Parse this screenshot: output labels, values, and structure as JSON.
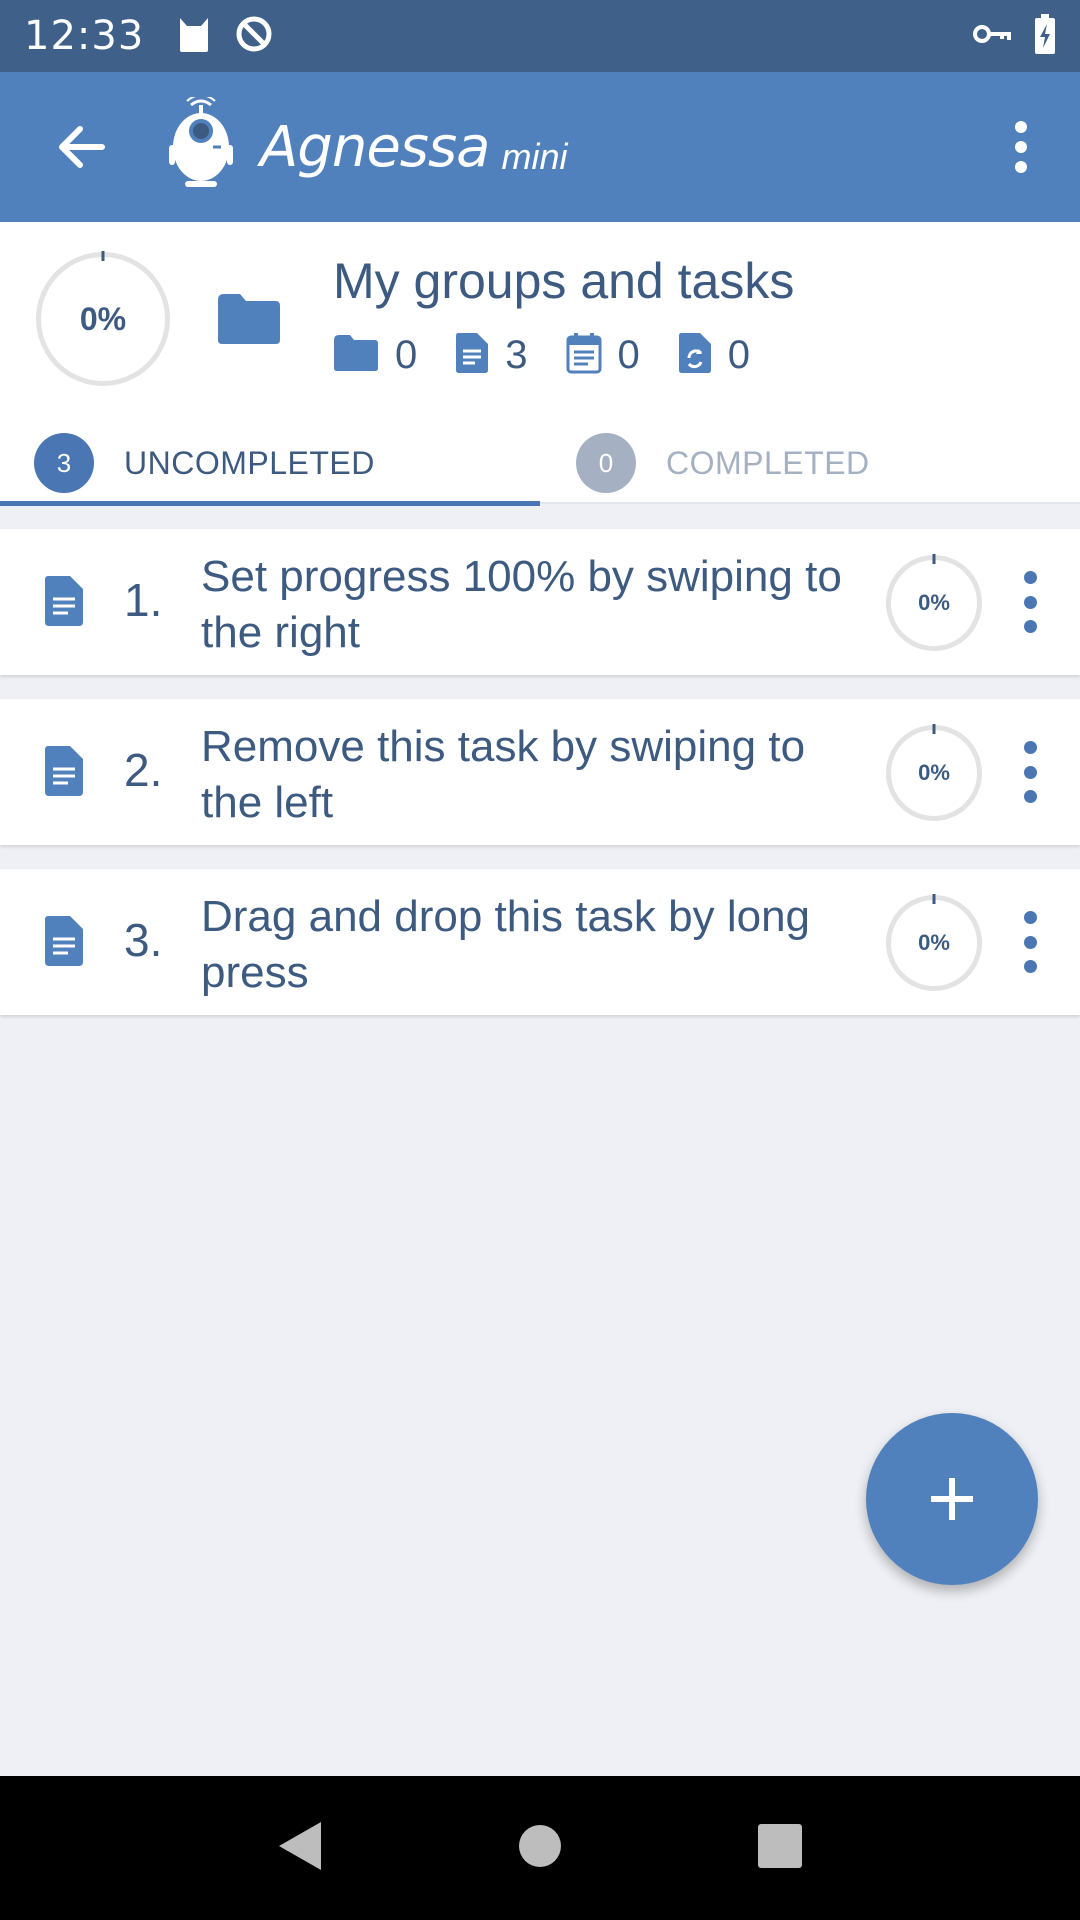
{
  "status_bar": {
    "time": "12:33"
  },
  "app_bar": {
    "title": "Agnessa",
    "title_suffix": "mini"
  },
  "header": {
    "progress_label": "0%",
    "title": "My groups and tasks",
    "counts": {
      "folders": "0",
      "tasks": "3",
      "scheduled": "0",
      "recurring": "0"
    }
  },
  "tabs": [
    {
      "badge": "3",
      "label": "UNCOMPLETED",
      "active": true
    },
    {
      "badge": "0",
      "label": "COMPLETED",
      "active": false
    }
  ],
  "tasks": [
    {
      "number": "1.",
      "text": "Set progress 100% by swiping to the right",
      "progress": "0%"
    },
    {
      "number": "2.",
      "text": "Remove this task by swiping to the left",
      "progress": "0%"
    },
    {
      "number": "3.",
      "text": "Drag and drop this task by long press",
      "progress": "0%"
    }
  ],
  "colors": {
    "primary": "#5181bd",
    "status_bar": "#3f6189",
    "text": "#3d5a80",
    "muted": "#a5b1c3",
    "background": "#eef0f5"
  }
}
